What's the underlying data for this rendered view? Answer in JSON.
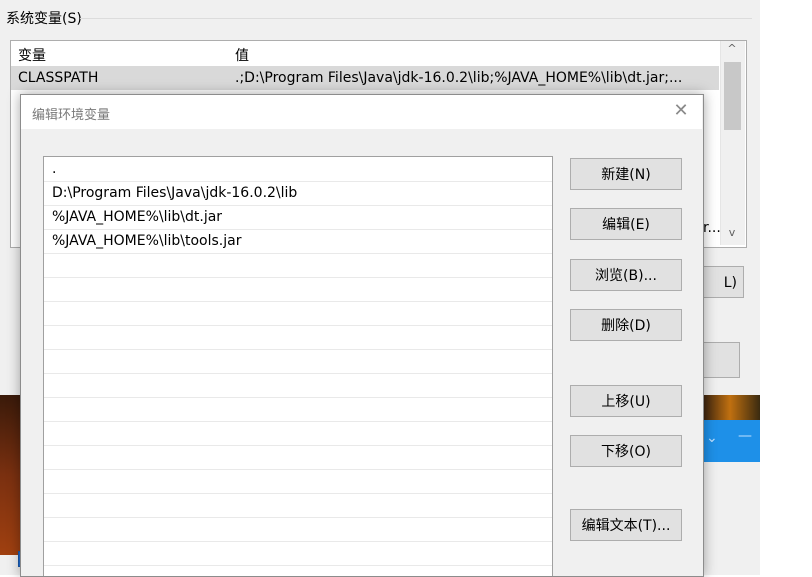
{
  "background": {
    "group_label": "系统变量(S)",
    "table": {
      "headers": [
        "变量",
        "值"
      ],
      "selected_row": {
        "name": "CLASSPATH",
        "value": ".;D:\\Program Files\\Java\\jdk-16.0.2\\lib;%JAVA_HOME%\\lib\\dt.jar;..."
      },
      "partial_cell_tail": "r...",
      "scroll_up": "^",
      "scroll_down": "v"
    },
    "partial_button_label": "L)"
  },
  "dialog": {
    "title": "编辑环境变量",
    "close": "✕",
    "entries": [
      ".",
      "D:\\Program Files\\Java\\jdk-16.0.2\\lib",
      "%JAVA_HOME%\\lib\\dt.jar",
      "%JAVA_HOME%\\lib\\tools.jar",
      "",
      "",
      "",
      "",
      "",
      "",
      "",
      "",
      "",
      "",
      "",
      "",
      "",
      ""
    ],
    "buttons": {
      "new": "新建(N)",
      "edit": "编辑(E)",
      "browse": "浏览(B)...",
      "delete": "删除(D)",
      "move_up": "上移(U)",
      "move_down": "下移(O)",
      "edit_text": "编辑文本(T)..."
    }
  },
  "colors": {
    "selected_row_bg": "#d9d9d9",
    "button_bg": "#e1e1e1",
    "accent_blue": "#1e90e8"
  }
}
